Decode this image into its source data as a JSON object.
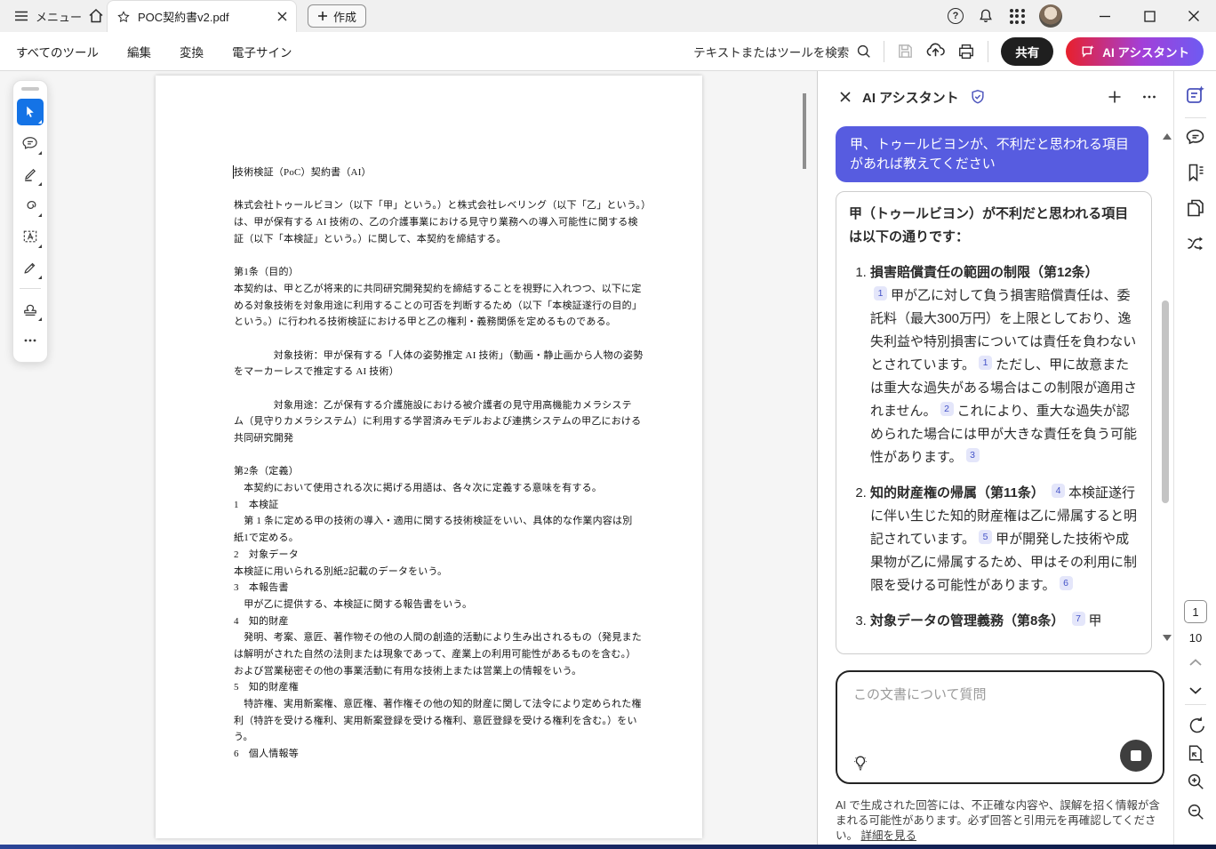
{
  "titlebar": {
    "menu_label": "メニュー",
    "tab_title": "POC契約書v2.pdf",
    "create_label": "作成",
    "help_glyph": "?"
  },
  "toolbar": {
    "items": [
      "すべてのツール",
      "編集",
      "変換",
      "電子サイン"
    ],
    "search_placeholder": "テキストまたはツールを検索",
    "share_label": "共有",
    "ai_label": "AI アシスタント"
  },
  "left_tools": [
    "select",
    "comment",
    "highlight",
    "draw",
    "text-select",
    "fill-sign",
    "stamp",
    "more"
  ],
  "document": {
    "lines": [
      "技術検証（PoC）契約書（AI）",
      "",
      "株式会社トゥールビヨン（以下「甲」という。）と株式会社レベリング（以下「乙」という。）",
      "は、甲が保有する AI 技術の、乙の介護事業における見守り業務への導入可能性に関する検",
      "証（以下「本検証」という。）に関して、本契約を締結する。",
      "",
      "第1条（目的）",
      "本契約は、甲と乙が将来的に共同研究開発契約を締結することを視野に入れつつ、以下に定",
      "める対象技術を対象用途に利用することの可否を判断するため（以下「本検証遂行の目的」",
      "という。）に行われる技術検証における甲と乙の権利・義務関係を定めるものである。",
      "",
      "　　　　対象技術：甲が保有する「人体の姿勢推定 AI 技術」（動画・静止画から人物の姿勢",
      "をマーカーレスで推定する AI 技術）",
      "",
      "　　　　対象用途：乙が保有する介護施設における被介護者の見守用高機能カメラシステ",
      "ム（見守りカメラシステム）に利用する学習済みモデルおよび連携システムの甲乙における",
      "共同研究開発",
      "",
      "第2条（定義）",
      "　本契約において使用される次に掲げる用語は、各々次に定義する意味を有する。",
      "1　本検証",
      "　第 1 条に定める甲の技術の導入・適用に関する技術検証をいい、具体的な作業内容は別",
      "紙1で定める。",
      "2　対象データ",
      "本検証に用いられる別紙2記載のデータをいう。",
      "3　本報告書",
      "　甲が乙に提供する、本検証に関する報告書をいう。",
      "4　知的財産",
      "　発明、考案、意匠、著作物その他の人間の創造的活動により生み出されるもの（発見また",
      "は解明がされた自然の法則または現象であって、産業上の利用可能性があるものを含む。）",
      "および営業秘密その他の事業活動に有用な技術上または営業上の情報をいう。",
      "5　知的財産権",
      "　特許権、実用新案権、意匠権、著作権その他の知的財産に関して法令により定められた権",
      "利（特許を受ける権利、実用新案登録を受ける権利、意匠登録を受ける権利を含む。）をい",
      "う。",
      "6　個人情報等"
    ]
  },
  "ai_panel": {
    "title": "AI アシスタント",
    "user_message": "甲、トゥールビヨンが、不利だと思われる項目があれば教えてください",
    "response": {
      "intro": "甲（トゥールビヨン）が不利だと思われる項目は以下の通りです：",
      "items": [
        {
          "title": "損害賠償責任の範囲の制限（第12条）",
          "newline": true,
          "body": [
            {
              "cite": "1"
            },
            {
              "text": "甲が乙に対して負う損害賠償責任は、委託料（最大300万円）を上限としており、逸失利益や特別損害については責任を負わないとされています。"
            },
            {
              "cite": "1"
            },
            {
              "text": "ただし、甲に故意または重大な過失がある場合はこの制限が適用されません。"
            },
            {
              "cite": "2"
            },
            {
              "text": "これにより、重大な過失が認められた場合には甲が大きな責任を負う可能性があります。"
            },
            {
              "cite": "3"
            }
          ]
        },
        {
          "title": "知的財産権の帰属（第11条）",
          "newline": false,
          "body": [
            {
              "cite": "4"
            },
            {
              "text": "本検証遂行に伴い生じた知的財産権は乙に帰属すると明記されています。"
            },
            {
              "cite": "5"
            },
            {
              "text": "甲が開発した技術や成果物が乙に帰属するため、甲はその利用に制限を受ける可能性があります。"
            },
            {
              "cite": "6"
            }
          ]
        },
        {
          "title": "対象データの管理義務（第8条）",
          "newline": false,
          "body": [
            {
              "cite": "7"
            },
            {
              "text": "甲"
            }
          ]
        }
      ]
    },
    "input_placeholder": "この文書について質問",
    "disclaimer": "AI で生成された回答には、不正確な内容や、誤解を招く情報が含まれる可能性があります。必ず回答と引用元を再確認してください。",
    "disclaimer_link": "詳細を見る"
  },
  "right_rail": {
    "page_current": "1",
    "page_total": "10"
  },
  "colors": {
    "accent_blue": "#1473e6",
    "user_bubble": "#575ce0",
    "ai_gradient_start": "#e8202c",
    "ai_gradient_end": "#6e5bf2",
    "share_bg": "#1f1f1f",
    "cite_bg": "#e4e6fa",
    "cite_fg": "#4453c8"
  }
}
